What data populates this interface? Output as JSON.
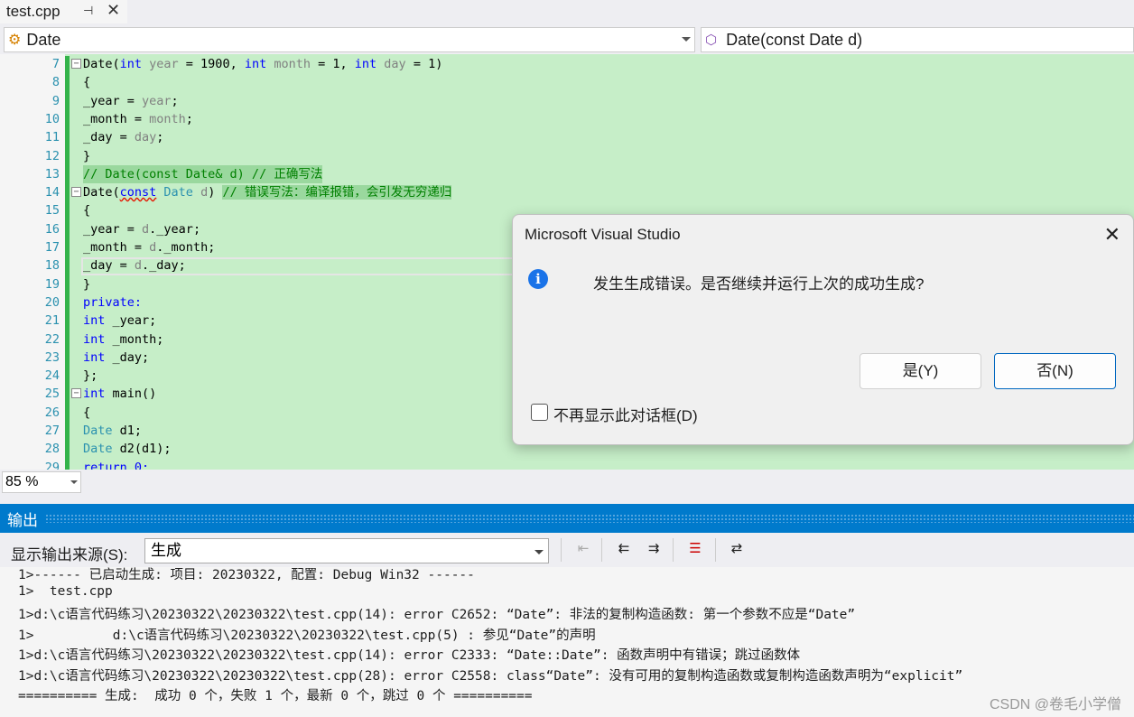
{
  "tab": {
    "title": "test.cpp",
    "pin_icon": "pin-icon",
    "close_icon": "close-icon"
  },
  "nav": {
    "class_combo": "Date",
    "member_combo": "Date(const Date d)"
  },
  "editor": {
    "lines": [
      {
        "n": "7",
        "fold": "−"
      },
      {
        "n": "8"
      },
      {
        "n": "9"
      },
      {
        "n": "10"
      },
      {
        "n": "11"
      },
      {
        "n": "12"
      },
      {
        "n": "13"
      },
      {
        "n": "14",
        "fold": "−"
      },
      {
        "n": "15"
      },
      {
        "n": "16"
      },
      {
        "n": "17"
      },
      {
        "n": "18"
      },
      {
        "n": "19"
      },
      {
        "n": "20"
      },
      {
        "n": "21"
      },
      {
        "n": "22"
      },
      {
        "n": "23"
      },
      {
        "n": "24"
      },
      {
        "n": "25",
        "fold": "−"
      },
      {
        "n": "26"
      },
      {
        "n": "27"
      },
      {
        "n": "28"
      },
      {
        "n": "29"
      }
    ],
    "code": {
      "l7": {
        "t1": "Date(",
        "kw1": "int",
        "p1": " year",
        "t2": " = 1900, ",
        "kw2": "int",
        "p2": " month",
        "t3": " = 1, ",
        "kw3": "int",
        "p3": " day",
        "t4": " = 1)"
      },
      "l8": "{",
      "l9": {
        "a": "_year = ",
        "b": "year",
        "c": ";"
      },
      "l10": {
        "a": "_month = ",
        "b": "month",
        "c": ";"
      },
      "l11": {
        "a": "_day = ",
        "b": "day",
        "c": ";"
      },
      "l12": "}",
      "l13": "// Date(const Date& d) // 正确写法",
      "l14": {
        "a": "Date(",
        "b": "const",
        "c": " ",
        "d": "Date",
        "e": " d",
        "f": ") ",
        "g": "// 错误写法：编译报错，会引发无穷递归"
      },
      "l15": "{",
      "l16": {
        "a": "_year = ",
        "b": "d",
        "c": "._year;"
      },
      "l17": {
        "a": "_month = ",
        "b": "d",
        "c": "._month;"
      },
      "l18": {
        "a": "_day = ",
        "b": "d",
        "c": "._day;"
      },
      "l19": "}",
      "l20": "private:",
      "l21": {
        "a": "int",
        "b": " _year;"
      },
      "l22": {
        "a": "int",
        "b": " _month;"
      },
      "l23": {
        "a": "int",
        "b": " _day;"
      },
      "l24": "};",
      "l25": {
        "a": "int",
        "b": " main()"
      },
      "l26": "{",
      "l27": {
        "a": "Date",
        "b": " d1;"
      },
      "l28": {
        "a": "Date",
        "b": " d2(d1);"
      },
      "l29": "return 0;"
    }
  },
  "zoom": "85 %",
  "output": {
    "header": "输出",
    "source_label": "显示输出来源(S):",
    "source_value": "生成",
    "lines": [
      "1>------ 已启动生成: 项目: 20230322, 配置: Debug Win32 ------",
      "1>  test.cpp",
      "1>d:\\c语言代码练习\\20230322\\20230322\\test.cpp(14): error C2652: “Date”: 非法的复制构造函数: 第一个参数不应是“Date”",
      "1>          d:\\c语言代码练习\\20230322\\20230322\\test.cpp(5) : 参见“Date”的声明",
      "1>d:\\c语言代码练习\\20230322\\20230322\\test.cpp(14): error C2333: “Date::Date”: 函数声明中有错误；跳过函数体",
      "1>d:\\c语言代码练习\\20230322\\20230322\\test.cpp(28): error C2558: class“Date”: 没有可用的复制构造函数或复制构造函数声明为“explicit”",
      "========== 生成:  成功 0 个，失败 1 个，最新 0 个，跳过 0 个 =========="
    ],
    "watermark": "CSDN @卷毛小学僧"
  },
  "dialog": {
    "title": "Microsoft Visual Studio",
    "message": "发生生成错误。是否继续并运行上次的成功生成?",
    "yes": "是(Y)",
    "no": "否(N)",
    "checkbox": "不再显示此对话框(D)"
  }
}
